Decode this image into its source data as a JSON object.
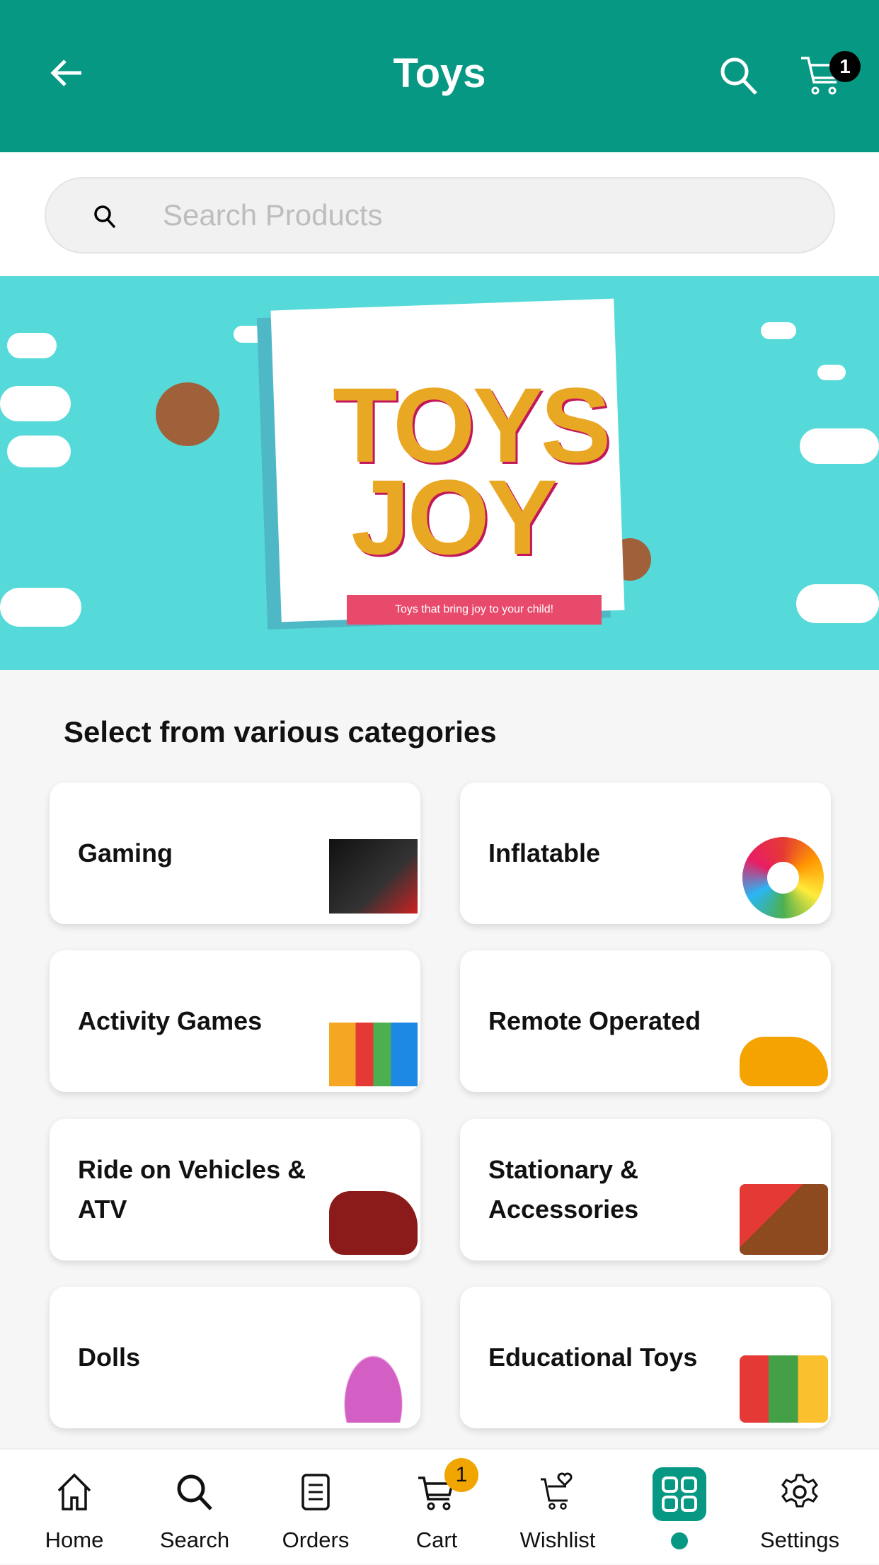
{
  "header": {
    "title": "Toys",
    "cart_count": "1"
  },
  "search": {
    "placeholder": "Search Products"
  },
  "banner": {
    "title": "TOYS JOY",
    "tagline": "Toys that bring joy to your child!"
  },
  "section_title": "Select from various categories",
  "categories": [
    {
      "label": "Gaming"
    },
    {
      "label": "Inflatable"
    },
    {
      "label": "Activity Games"
    },
    {
      "label": "Remote Operated"
    },
    {
      "label": "Ride on Vehicles & ATV"
    },
    {
      "label": "Stationary & Accessories"
    },
    {
      "label": "Dolls"
    },
    {
      "label": "Educational Toys"
    }
  ],
  "nav": {
    "items": [
      {
        "label": "Home"
      },
      {
        "label": "Search"
      },
      {
        "label": "Orders"
      },
      {
        "label": "Cart"
      },
      {
        "label": "Wishlist"
      },
      {
        "label": ""
      },
      {
        "label": "Settings"
      }
    ],
    "cart_badge": "1"
  },
  "colors": {
    "primary": "#079884",
    "badge": "#f0a500"
  }
}
